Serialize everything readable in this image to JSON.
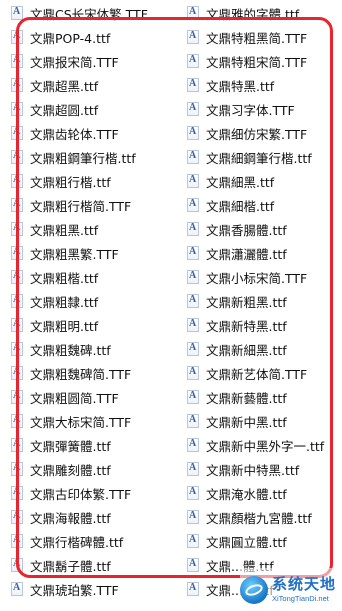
{
  "file_list": {
    "left_column": [
      "文鼎CS长宋体繁.TTF",
      "文鼎POP-4.ttf",
      "文鼎报宋简.TTF",
      "文鼎超黑.ttf",
      "文鼎超圆.ttf",
      "文鼎齿轮体.TTF",
      "文鼎粗鋼筆行楷.ttf",
      "文鼎粗行楷.ttf",
      "文鼎粗行楷简.TTF",
      "文鼎粗黑.ttf",
      "文鼎粗黑繁.TTF",
      "文鼎粗楷.ttf",
      "文鼎粗隸.ttf",
      "文鼎粗明.ttf",
      "文鼎粗魏碑.ttf",
      "文鼎粗魏碑简.TTF",
      "文鼎粗圆简.TTF",
      "文鼎大标宋简.TTF",
      "文鼎彈簧體.ttf",
      "文鼎雕刻體.ttf",
      "文鼎古印体繁.TTF",
      "文鼎海報體.ttf",
      "文鼎行楷碑體.ttf",
      "文鼎鬍子體.ttf",
      "文鼎琥珀繁.TTF"
    ],
    "right_column": [
      "文鼎雅的字體.ttf",
      "文鼎特粗黑简.TTF",
      "文鼎特粗宋简.TTF",
      "文鼎特黑.ttf",
      "文鼎习字体.TTF",
      "文鼎细仿宋繁.TTF",
      "文鼎細鋼筆行楷.ttf",
      "文鼎細黑.ttf",
      "文鼎細楷.ttf",
      "文鼎香腸體.ttf",
      "文鼎瀟灑體.ttf",
      "文鼎小标宋简.TTF",
      "文鼎新粗黑.ttf",
      "文鼎新特黑.ttf",
      "文鼎新細黑.ttf",
      "文鼎新艺体简.TTF",
      "文鼎新藝體.ttf",
      "文鼎新中黑.ttf",
      "文鼎新中黑外字一.ttf",
      "文鼎新中特黑.ttf",
      "文鼎淹水體.ttf",
      "文鼎顏楷九宮體.ttf",
      "文鼎圓立體.ttf",
      "文鼎...體.ttf",
      "文鼎...體.ttf"
    ]
  },
  "icons": {
    "file_type": "font-file-icon"
  },
  "highlight": {
    "color": "#e8242f"
  },
  "watermark": {
    "title": "系统天地",
    "subtitle": "XiTongTianDi.net"
  }
}
